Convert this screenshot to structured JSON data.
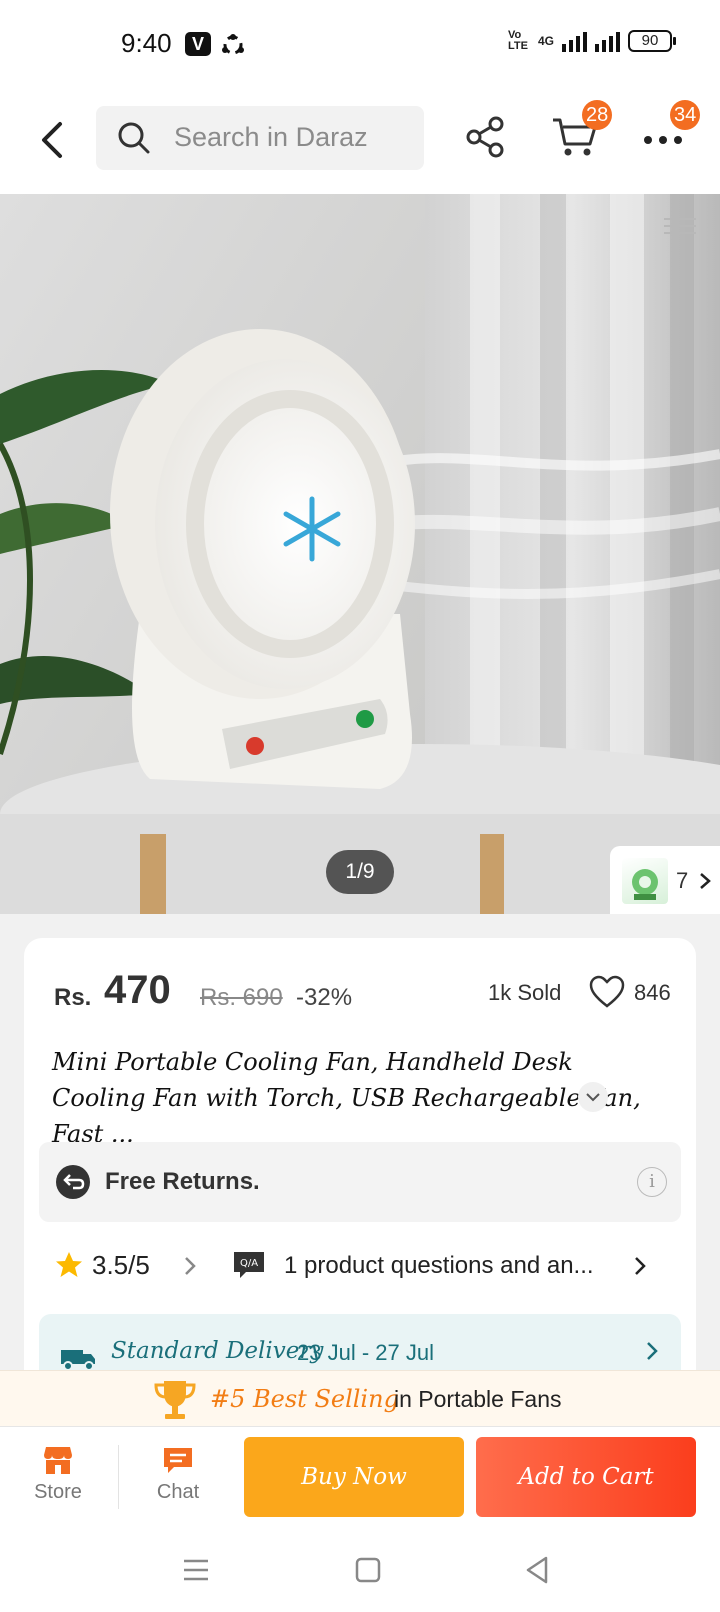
{
  "status_bar": {
    "time": "9:40",
    "app_badge": "V",
    "network_label": "4G",
    "volte_label": "Vo LTE",
    "battery": "90"
  },
  "header": {
    "search_placeholder": "Search in Daraz",
    "cart_badge": "28",
    "more_badge": "34",
    "icons": [
      "back-arrow-icon",
      "search-icon",
      "share-icon",
      "cart-icon",
      "more-icon"
    ]
  },
  "gallery": {
    "counter": "1/9",
    "variant_count": "7",
    "colors": {
      "wall_left": "#d6d6d4",
      "wall_right": "#c9c9c9",
      "table": "#e6e6e6"
    }
  },
  "product": {
    "currency": "Rs.",
    "price": "470",
    "original_price": "Rs. 690",
    "discount": "-32%",
    "sold": "1k Sold",
    "likes": "846",
    "title": "Mini Portable Cooling Fan, Handheld Desk Cooling Fan with Torch, USB Rechargeable Fan, Fast ...",
    "returns_label": "Free Returns.",
    "info_label": "i",
    "rating": "3.5/5",
    "qa_badge": "Q/A",
    "qa_text": "1 product questions and an...",
    "delivery_label": "Standard Delivery",
    "delivery_dates": "23 Jul - 27 Jul"
  },
  "best_selling": {
    "rank": "#5 Best Selling",
    "category": "in Portable Fans"
  },
  "action_bar": {
    "store_label": "Store",
    "chat_label": "Chat",
    "buy_now_label": "Buy Now",
    "add_to_cart_label": "Add to Cart"
  },
  "theme": {
    "accent_orange": "#f36d21",
    "buy_now": "#fba71b",
    "add_to_cart": "#fb3e1d",
    "delivery_teal": "#1a6f7a"
  }
}
